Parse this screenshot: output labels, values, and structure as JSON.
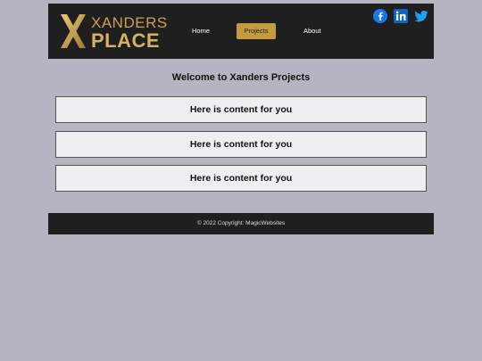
{
  "header": {
    "logo": {
      "line1": "XANDERS",
      "line2": "PLACE"
    },
    "nav": {
      "home": "Home",
      "projects": "Projects",
      "about": "About"
    },
    "social": [
      "facebook-icon",
      "linkedin-icon",
      "twitter-icon"
    ],
    "colors": {
      "background": "#1f1f1f",
      "accent": "#c59b3e"
    }
  },
  "main": {
    "title": "Welcome to Xanders Projects",
    "cards": [
      "Here is content for you",
      "Here is content for you",
      "Here is content for you"
    ]
  },
  "footer": {
    "text": "© 2022 Copyright: MagicWebsites"
  },
  "page": {
    "background": "#b5b4c1"
  }
}
